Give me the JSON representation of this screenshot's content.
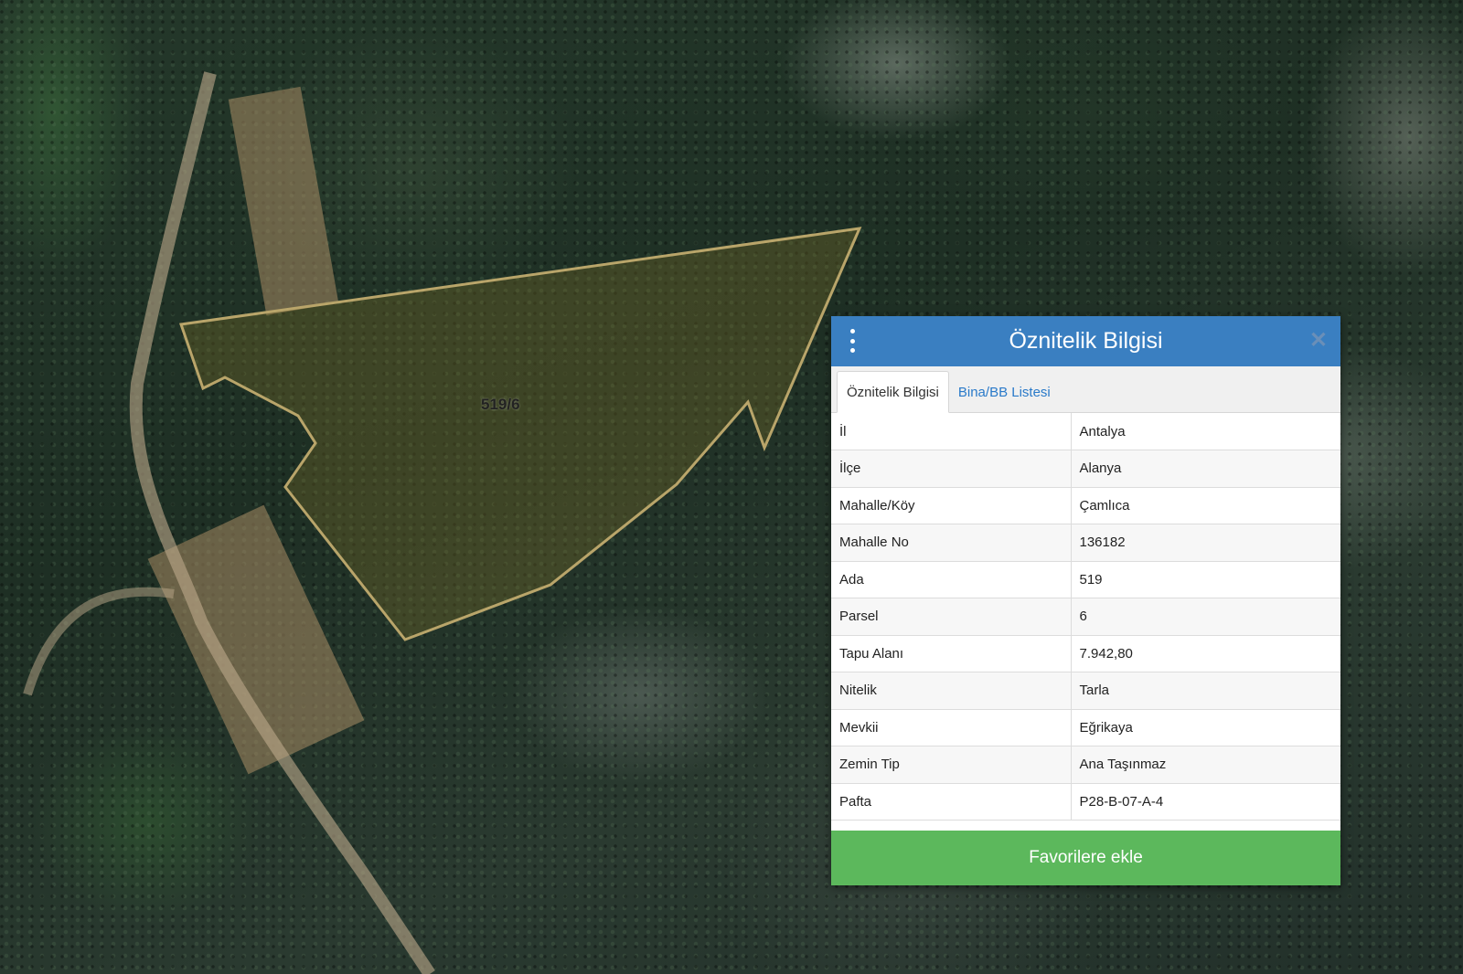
{
  "map": {
    "parcel_label": "519/6",
    "parcel_outline_color": "#b9a56a"
  },
  "panel": {
    "title": "Öznitelik Bilgisi",
    "tabs": [
      {
        "label": "Öznitelik Bilgisi",
        "active": true
      },
      {
        "label": "Bina/BB Listesi",
        "active": false
      }
    ],
    "rows": [
      {
        "key": "İl",
        "value": "Antalya"
      },
      {
        "key": "İlçe",
        "value": "Alanya"
      },
      {
        "key": "Mahalle/Köy",
        "value": "Çamlıca"
      },
      {
        "key": "Mahalle No",
        "value": "136182"
      },
      {
        "key": "Ada",
        "value": "519"
      },
      {
        "key": "Parsel",
        "value": "6"
      },
      {
        "key": "Tapu Alanı",
        "value": "7.942,80"
      },
      {
        "key": "Nitelik",
        "value": "Tarla"
      },
      {
        "key": "Mevkii",
        "value": "Eğrikaya"
      },
      {
        "key": "Zemin Tip",
        "value": "Ana Taşınmaz"
      },
      {
        "key": "Pafta",
        "value": "P28-B-07-A-4"
      }
    ],
    "favorite_button": "Favorilere ekle",
    "header_color": "#3a7fc1",
    "button_color": "#5cb85c",
    "icons": {
      "menu": "vertical-dots-icon",
      "close": "close-icon"
    }
  }
}
